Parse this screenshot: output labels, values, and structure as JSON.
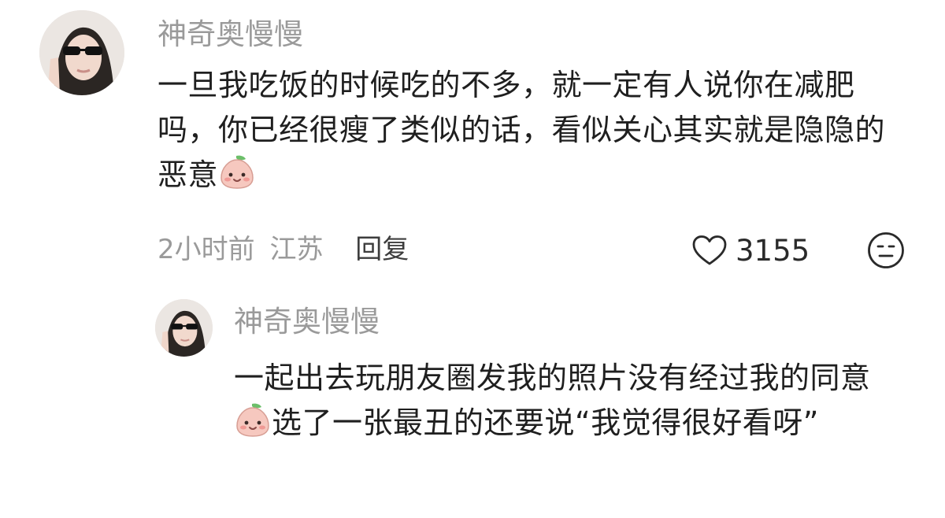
{
  "comments": [
    {
      "username": "神奇奥慢慢",
      "text_before_emoji": "一旦我吃饭的时候吃的不多，就一定有人说你在减肥吗，你已经很瘦了类似的话，看似关心其实就是隐隐的恶意",
      "text_after_emoji": "",
      "emoji": "peach-face-emoji",
      "time": "2小时前",
      "location": "江苏",
      "reply_label": "回复",
      "like_count": "3155",
      "like_icon": "heart-outline-icon",
      "react_icon": "neutral-face-icon"
    },
    {
      "username": "神奇奥慢慢",
      "text_before_emoji": "一起出去玩朋友圈发我的照片没有经过我的同意",
      "text_after_emoji": "选了一张最丑的还要说“我觉得很好看呀”",
      "emoji": "peach-face-emoji"
    }
  ],
  "colors": {
    "text": "#1f1f1f",
    "muted": "#9a9a9a",
    "emoji_fill": "#f6c8bf",
    "emoji_leaf": "#6cbf6a"
  }
}
